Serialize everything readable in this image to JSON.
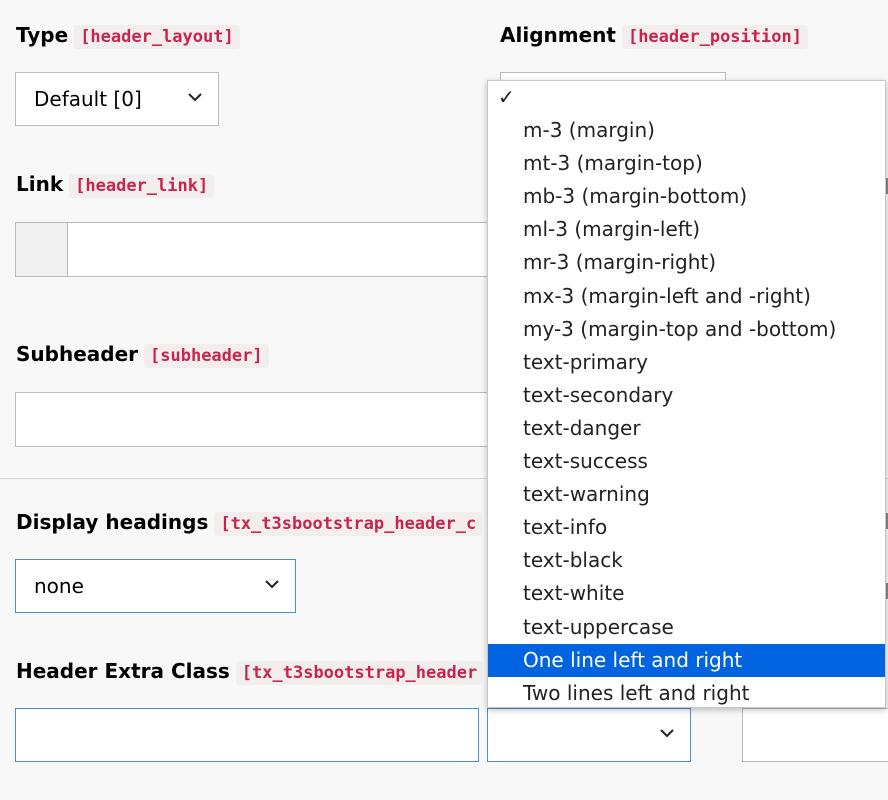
{
  "type_field": {
    "label": "Type",
    "code": "[header_layout]",
    "value": "Default [0]"
  },
  "alignment_field": {
    "label": "Alignment",
    "code": "[header_position]"
  },
  "link_field": {
    "label": "Link",
    "code": "[header_link]",
    "value": ""
  },
  "subheader_field": {
    "label": "Subheader",
    "code": "[subheader]",
    "value": ""
  },
  "display_headings_field": {
    "label": "Display headings",
    "code": "[tx_t3sbootstrap_header_c",
    "value": "none"
  },
  "header_extra_class_field": {
    "label": "Header Extra Class",
    "code": "[tx_t3sbootstrap_header",
    "value": ""
  },
  "alignment_dropdown": {
    "checkmark": "✓",
    "options": [
      "m-3 (margin)",
      "mt-3 (margin-top)",
      "mb-3 (margin-bottom)",
      "ml-3 (margin-left)",
      "mr-3 (margin-right)",
      "mx-3 (margin-left and -right)",
      "my-3 (margin-top and -bottom)",
      "text-primary",
      "text-secondary",
      "text-danger",
      "text-success",
      "text-warning",
      "text-info",
      "text-black",
      "text-white",
      "text-uppercase",
      "One line left and right",
      "Two lines left and right"
    ],
    "selected": "One line left and right"
  },
  "colors": {
    "accent": "#0064e1",
    "code": "#c7254e",
    "focus_border": "#4a90d9"
  },
  "icons": {
    "select_arrow": "chevron-down-icon"
  }
}
